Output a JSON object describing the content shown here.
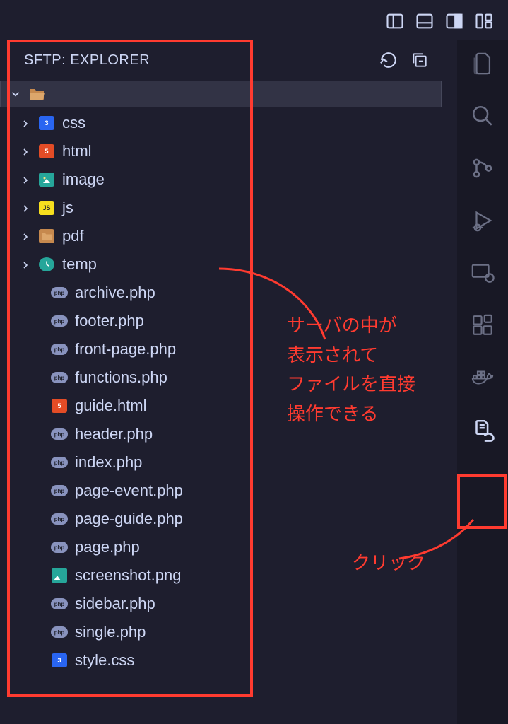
{
  "sidebar": {
    "title": "SFTP: EXPLORER"
  },
  "tree": {
    "folders": [
      {
        "label": "css",
        "icon": "css3"
      },
      {
        "label": "html",
        "icon": "html5"
      },
      {
        "label": "image",
        "icon": "image"
      },
      {
        "label": "js",
        "icon": "js"
      },
      {
        "label": "pdf",
        "icon": "folder"
      },
      {
        "label": "temp",
        "icon": "temp"
      }
    ],
    "files": [
      {
        "label": "archive.php",
        "icon": "php"
      },
      {
        "label": "footer.php",
        "icon": "php"
      },
      {
        "label": "front-page.php",
        "icon": "php"
      },
      {
        "label": "functions.php",
        "icon": "php"
      },
      {
        "label": "guide.html",
        "icon": "html5"
      },
      {
        "label": "header.php",
        "icon": "php"
      },
      {
        "label": "index.php",
        "icon": "php"
      },
      {
        "label": "page-event.php",
        "icon": "php"
      },
      {
        "label": "page-guide.php",
        "icon": "php"
      },
      {
        "label": "page.php",
        "icon": "php"
      },
      {
        "label": "screenshot.png",
        "icon": "png"
      },
      {
        "label": "sidebar.php",
        "icon": "php"
      },
      {
        "label": "single.php",
        "icon": "php"
      },
      {
        "label": "style.css",
        "icon": "css3"
      }
    ]
  },
  "annotations": {
    "main_text": "サーバの中が\n表示されて\nファイルを直接\n操作できる",
    "click_text": "クリック"
  }
}
